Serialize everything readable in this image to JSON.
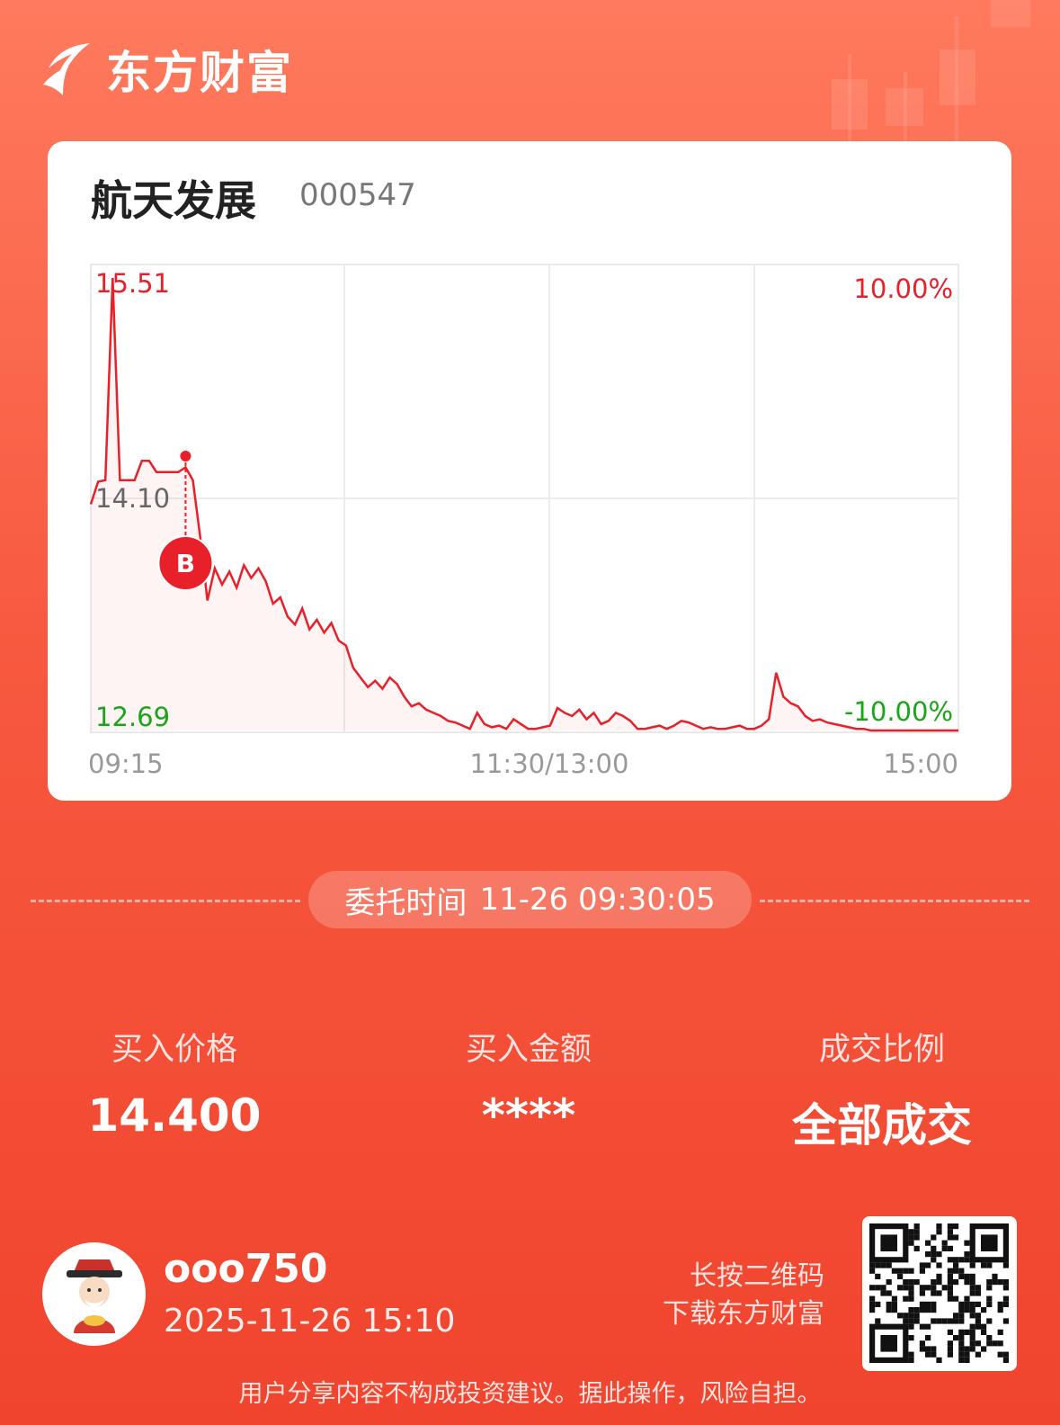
{
  "brand": {
    "name": "东方财富"
  },
  "stock": {
    "name": "航天发展",
    "code": "000547"
  },
  "chart_data": {
    "type": "line",
    "y_ticks": {
      "high": "15.51",
      "mid": "14.10",
      "low": "12.69"
    },
    "pct_ticks": {
      "high": "10.00%",
      "low": "-10.00%"
    },
    "x_ticks": [
      "09:15",
      "11:30/13:00",
      "15:00"
    ],
    "ylim": [
      12.69,
      15.51
    ],
    "prev_close": 14.1,
    "marker": {
      "label": "B",
      "price": 14.4
    },
    "colors": {
      "up": "#e8202a",
      "down": "#1aa51a",
      "line": "#e8202a",
      "mid": "#666666"
    },
    "series": [
      {
        "values": [
          14.1,
          14.24,
          14.25,
          15.51,
          14.25,
          14.25,
          14.25,
          14.37,
          14.37,
          14.3,
          14.3,
          14.3,
          14.3,
          14.33,
          14.25,
          13.9,
          13.5,
          13.7,
          13.6,
          13.68,
          13.58,
          13.72,
          13.64,
          13.7,
          13.62,
          13.48,
          13.52,
          13.4,
          13.35,
          13.45,
          13.32,
          13.38,
          13.3,
          13.36,
          13.25,
          13.22,
          13.08,
          13.02,
          12.96,
          13.0,
          12.95,
          13.02,
          12.98,
          12.9,
          12.84,
          12.86,
          12.82,
          12.8,
          12.78,
          12.75,
          12.74,
          12.72,
          12.7,
          12.8,
          12.73,
          12.71,
          12.72,
          12.7,
          12.76,
          12.73,
          12.7,
          12.7,
          12.71,
          12.72,
          12.83,
          12.8,
          12.78,
          12.82,
          12.76,
          12.8,
          12.73,
          12.75,
          12.8,
          12.78,
          12.75,
          12.7,
          12.7,
          12.71,
          12.72,
          12.7,
          12.72,
          12.75,
          12.74,
          12.72,
          12.7,
          12.71,
          12.7,
          12.7,
          12.71,
          12.72,
          12.7,
          12.7,
          12.72,
          12.76,
          13.05,
          12.9,
          12.86,
          12.84,
          12.78,
          12.75,
          12.76,
          12.74,
          12.73,
          12.72,
          12.71,
          12.7,
          12.7,
          12.69,
          12.69,
          12.69,
          12.69,
          12.69,
          12.69,
          12.69,
          12.69,
          12.69,
          12.69,
          12.69,
          12.69,
          12.69
        ]
      }
    ]
  },
  "order": {
    "label": "委托时间",
    "time": "11-26 09:30:05"
  },
  "stats": [
    {
      "label": "买入价格",
      "value": "14.400"
    },
    {
      "label": "买入金额",
      "value": "****"
    },
    {
      "label": "成交比例",
      "value": "全部成交"
    }
  ],
  "user": {
    "name": "ooo750",
    "datetime": "2025-11-26 15:10"
  },
  "qr_hint": {
    "line1": "长按二维码",
    "line2": "下载东方财富"
  },
  "disclaimer": "用户分享内容不构成投资建议。据此操作，风险自担。"
}
